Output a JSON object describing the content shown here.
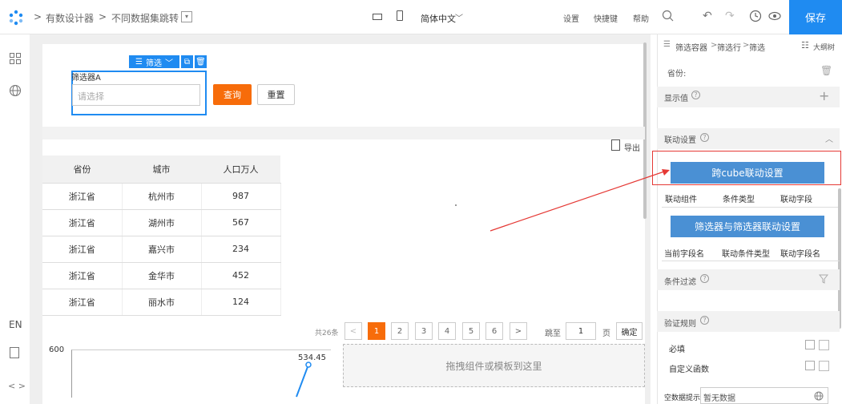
{
  "header": {
    "breadcrumb_1": "有数设计器",
    "breadcrumb_2": "不同数据集跳转",
    "language": "简体中文",
    "settings": "设置",
    "shortcuts": "快捷键",
    "help": "帮助",
    "save": "保存"
  },
  "rail": {
    "lang": "EN"
  },
  "filter": {
    "tag_label": "筛选",
    "title": "筛选器A",
    "placeholder": "请选择",
    "query": "查询",
    "reset": "重置"
  },
  "export": "导出",
  "table": {
    "headers": [
      "省份",
      "城市",
      "人口万人"
    ],
    "rows": [
      [
        "浙江省",
        "杭州市",
        "987"
      ],
      [
        "浙江省",
        "湖州市",
        "567"
      ],
      [
        "浙江省",
        "嘉兴市",
        "234"
      ],
      [
        "浙江省",
        "金华市",
        "452"
      ],
      [
        "浙江省",
        "丽水市",
        "124"
      ]
    ]
  },
  "pager": {
    "total": "共26条",
    "pages": [
      "1",
      "2",
      "3",
      "4",
      "5",
      "6"
    ],
    "jump_to": "跳至",
    "jump_value": "1",
    "page_unit": "页",
    "confirm": "确定"
  },
  "dropzone": "拖拽组件或模板到这里",
  "chart": {
    "y_tick": "600",
    "label": "534.45"
  },
  "panel": {
    "breadcrumb_1": "筛选容器",
    "breadcrumb_2": "筛选行",
    "breadcrumb_3": "筛选",
    "outline": "大纲树",
    "province": "省份:",
    "display_value": "显示值",
    "linkage": "联动设置",
    "cube_btn": "跨cube联动设置",
    "cols1": [
      "联动组件",
      "条件类型",
      "联动字段"
    ],
    "filter_btn": "筛选器与筛选器联动设置",
    "cols2": [
      "当前字段名",
      "联动条件类型",
      "联动字段名"
    ],
    "cond_filter": "条件过滤",
    "validation": "验证规则",
    "required": "必填",
    "custom_fn": "自定义函数",
    "empty_hint": "空数据提示",
    "empty_value": "暂无数据"
  },
  "colors": {
    "accent": "#1f8bf1",
    "orange": "#f76c0a",
    "panel_btn": "#4a90d4",
    "highlight": "#e53935"
  }
}
